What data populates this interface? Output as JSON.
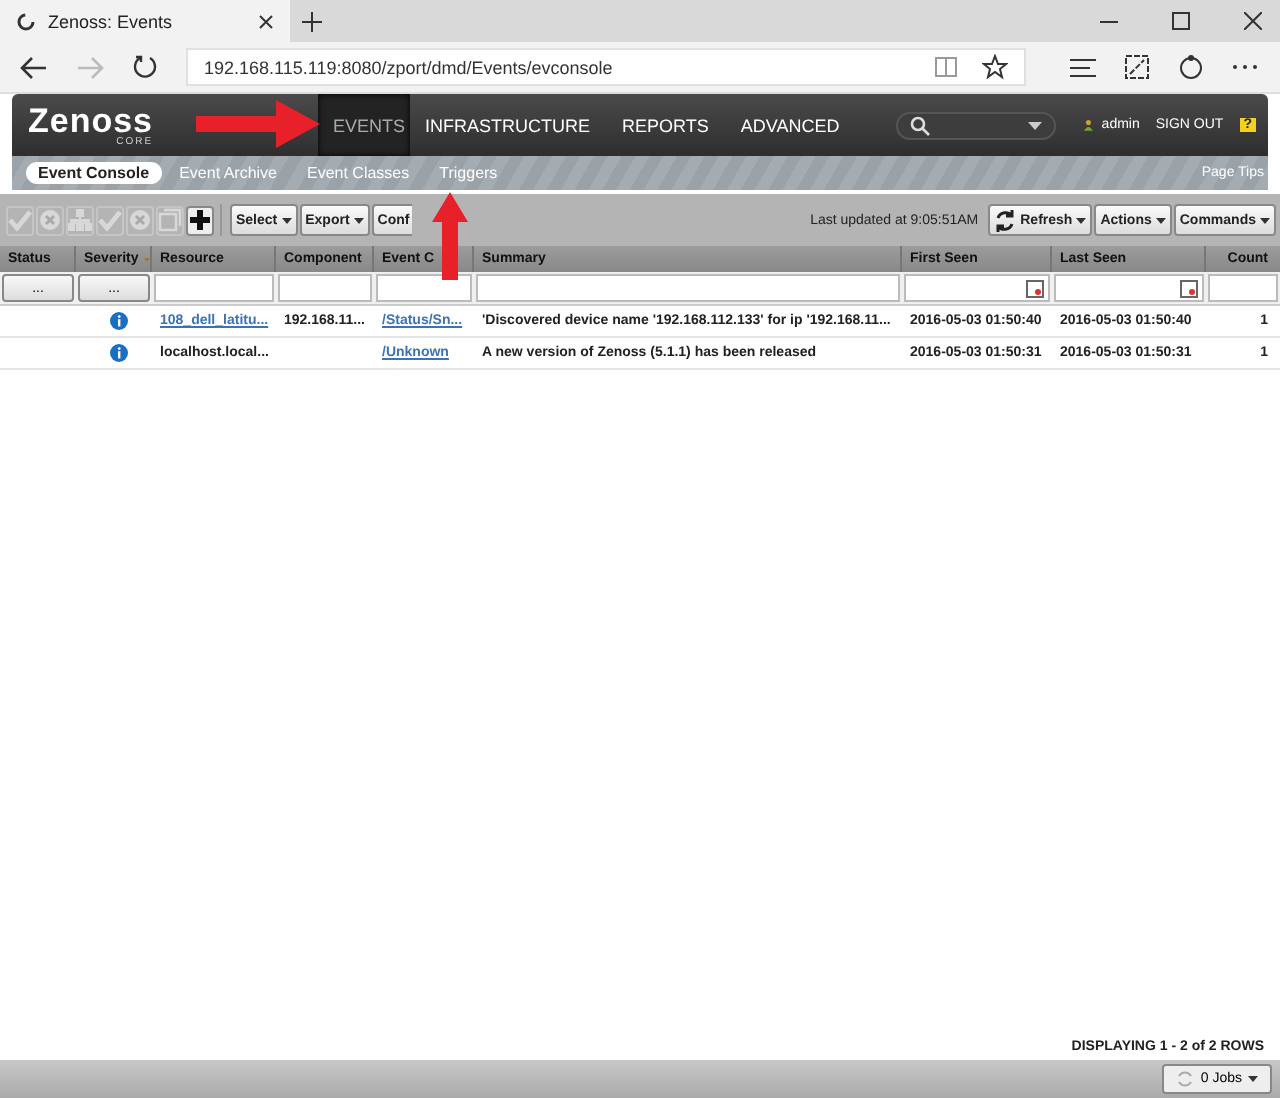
{
  "browser": {
    "tab_title": "Zenoss: Events",
    "url": "192.168.115.119:8080/zport/dmd/Events/evconsole"
  },
  "header": {
    "logo": "Zenoss",
    "logo_sub": "CORE",
    "nav": [
      {
        "label": "EVENTS",
        "selected": true
      },
      {
        "label": "INFRASTRUCTURE",
        "selected": false
      },
      {
        "label": "REPORTS",
        "selected": false
      },
      {
        "label": "ADVANCED",
        "selected": false
      }
    ],
    "user": "admin",
    "sign_out": "SIGN OUT",
    "help": "?"
  },
  "subnav": [
    {
      "label": "Event Console",
      "selected": true
    },
    {
      "label": "Event Archive",
      "selected": false
    },
    {
      "label": "Event Classes",
      "selected": false
    },
    {
      "label": "Triggers",
      "selected": false
    }
  ],
  "page_tips": "Page Tips",
  "toolbar": {
    "icon_buttons": [
      {
        "kind": "check",
        "disabled": true
      },
      {
        "kind": "cancel",
        "disabled": true
      },
      {
        "kind": "tree",
        "disabled": true
      },
      {
        "kind": "check",
        "disabled": true
      },
      {
        "kind": "cancel",
        "disabled": true
      },
      {
        "kind": "copy",
        "disabled": true
      },
      {
        "kind": "plus",
        "disabled": false
      }
    ],
    "menus": [
      {
        "label": "Select",
        "caret": true
      },
      {
        "label": "Export",
        "caret": true
      },
      {
        "label": "Conf",
        "caret": false
      }
    ],
    "last_updated": "Last updated at 9:05:51AM",
    "right_menus": [
      "Refresh",
      "Actions",
      "Commands"
    ]
  },
  "table": {
    "columns": [
      {
        "label": "Status",
        "sorted": false,
        "filter": {
          "kind": "button",
          "label": "..."
        }
      },
      {
        "label": "Severity",
        "sorted": true,
        "filter": {
          "kind": "button",
          "label": "..."
        }
      },
      {
        "label": "Resource",
        "sorted": false,
        "filter": {
          "kind": "field"
        }
      },
      {
        "label": "Component",
        "sorted": false,
        "filter": {
          "kind": "field"
        }
      },
      {
        "label": "Event C",
        "sorted": false,
        "filter": {
          "kind": "field"
        }
      },
      {
        "label": "Summary",
        "sorted": false,
        "filter": {
          "kind": "field"
        }
      },
      {
        "label": "First Seen",
        "sorted": false,
        "filter": {
          "kind": "date"
        }
      },
      {
        "label": "Last Seen",
        "sorted": false,
        "filter": {
          "kind": "date"
        }
      },
      {
        "label": "Count",
        "sorted": false,
        "filter": {
          "kind": "field"
        }
      }
    ],
    "rows": [
      {
        "severity": {
          "kind": "info"
        },
        "resource": "108_dell_latitu...",
        "resource_link": true,
        "component": "192.168.11...",
        "event_class": "/Status/Sn...",
        "summary": "'Discovered device name '192.168.112.133' for ip '192.168.11...",
        "first_seen": "2016-05-03 01:50:40",
        "last_seen": "2016-05-03 01:50:40",
        "count": "1"
      },
      {
        "severity": {
          "kind": "info"
        },
        "resource": "localhost.local...",
        "resource_link": false,
        "component": "",
        "event_class": "/Unknown",
        "summary": "A new version of Zenoss (5.1.1) has been released",
        "first_seen": "2016-05-03 01:50:31",
        "last_seen": "2016-05-03 01:50:31",
        "count": "1"
      }
    ],
    "paging": "DISPLAYING 1 - 2 of 2 ROWS"
  },
  "jobs": "0 Jobs"
}
